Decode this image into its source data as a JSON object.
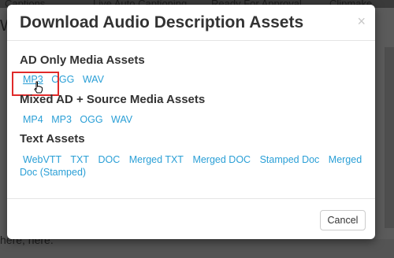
{
  "modal": {
    "title": "Download Audio Description Assets",
    "close_glyph": "×"
  },
  "sections": {
    "ad_only": {
      "heading": "AD Only Media Assets",
      "links": [
        "MP3",
        "OGG",
        "WAV"
      ]
    },
    "mixed": {
      "heading": "Mixed AD + Source Media Assets",
      "links": [
        "MP4",
        "MP3",
        "OGG",
        "WAV"
      ]
    },
    "text": {
      "heading": "Text Assets",
      "links": [
        "WebVTT",
        "TXT",
        "DOC",
        "Merged TXT",
        "Merged DOC",
        "Stamped Doc",
        "Merged Doc (Stamped)"
      ]
    }
  },
  "footer": {
    "cancel_label": "Cancel"
  },
  "background": {
    "fragments": [
      "Captions",
      "Live Auto Captioning",
      "Ready For Approval",
      "Clipmake",
      "Wi",
      "here, here."
    ]
  },
  "colors": {
    "link": "#2a9fd6",
    "highlight": "#e02a2a"
  }
}
